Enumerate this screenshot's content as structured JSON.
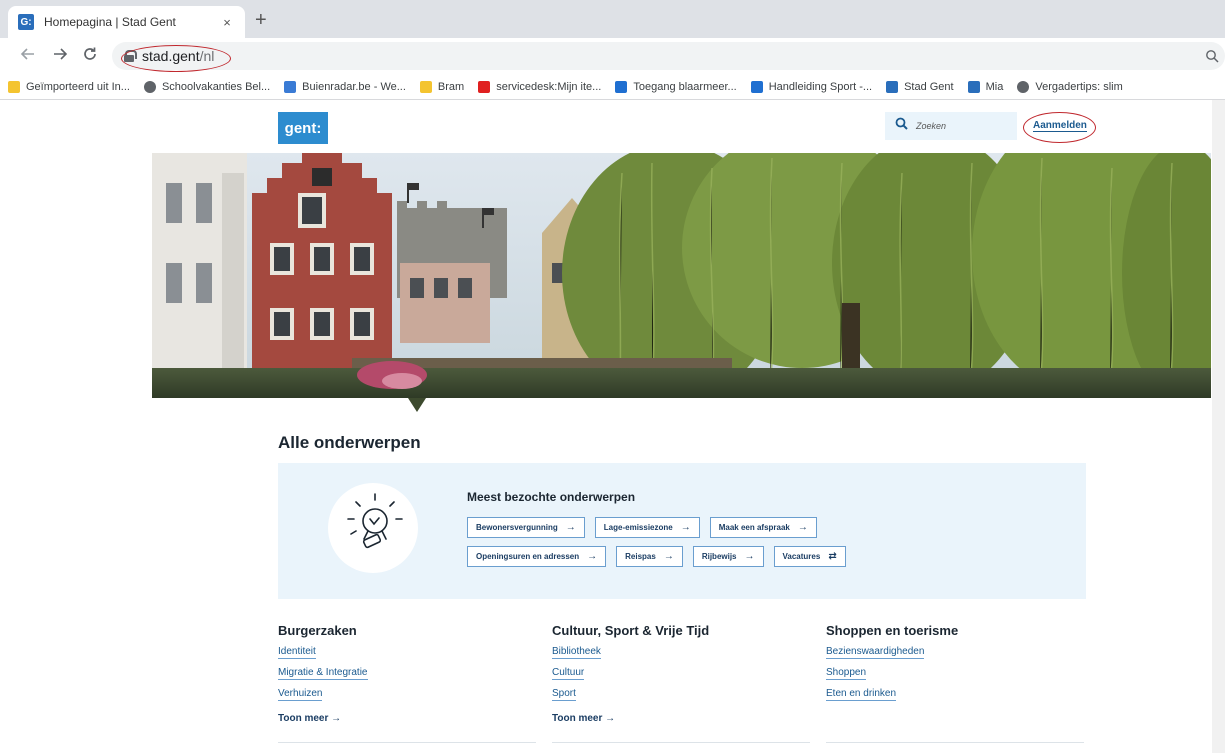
{
  "browser": {
    "tab_title": "Homepagina | Stad Gent",
    "favicon_text": "G:",
    "tab_close": "×",
    "new_tab": "+",
    "url_host": "stad.gent",
    "url_path": "/nl",
    "bookmarks": [
      {
        "label": "Geïmporteerd uit In...",
        "icon": "folder-icon",
        "color": "#f4c430"
      },
      {
        "label": "Schoolvakanties Bel...",
        "icon": "globe-icon",
        "color": "#5f6368"
      },
      {
        "label": "Buienradar.be - We...",
        "icon": "buienradar-icon",
        "color": "#3a7bd5"
      },
      {
        "label": "Bram",
        "icon": "folder-icon",
        "color": "#f4c430"
      },
      {
        "label": "servicedesk:Mijn ite...",
        "icon": "flag-icon",
        "color": "#e02020"
      },
      {
        "label": "Toegang blaarmeer...",
        "icon": "toegang-icon",
        "color": "#1f6fd1"
      },
      {
        "label": "Handleiding Sport -...",
        "icon": "cross-icon",
        "color": "#1f6fd1"
      },
      {
        "label": "Stad Gent",
        "icon": "gent-icon",
        "color": "#2a6ebb"
      },
      {
        "label": "Mia",
        "icon": "mia-icon",
        "color": "#2a6ebb"
      },
      {
        "label": "Vergadertips: slim",
        "icon": "globe-icon",
        "color": "#5f6368"
      }
    ]
  },
  "header": {
    "logo": "gent:",
    "search_placeholder": "Zoeken",
    "login_label": "Aanmelden"
  },
  "main": {
    "section_title": "Alle onderwerpen",
    "topics_heading": "Meest bezochte onderwerpen",
    "chips_row1": [
      {
        "label": "Bewonersvergunning",
        "arrow": "→"
      },
      {
        "label": "Lage-emissiezone",
        "arrow": "→"
      },
      {
        "label": "Maak een afspraak",
        "arrow": "→"
      }
    ],
    "chips_row2": [
      {
        "label": "Openingsuren en adressen",
        "arrow": "→"
      },
      {
        "label": "Reispas",
        "arrow": "→"
      },
      {
        "label": "Rijbewijs",
        "arrow": "→"
      },
      {
        "label": "Vacatures",
        "arrow": "⇄"
      }
    ],
    "columns": [
      {
        "title": "Burgerzaken",
        "links": [
          "Identiteit",
          "Migratie & Integratie",
          "Verhuizen"
        ],
        "more": "Toon meer →"
      },
      {
        "title": "Cultuur, Sport & Vrije Tijd",
        "links": [
          "Bibliotheek",
          "Cultuur",
          "Sport"
        ],
        "more": "Toon meer →"
      },
      {
        "title": "Shoppen en toerisme",
        "links": [
          "Bezienswaardigheden",
          "Shoppen",
          "Eten en drinken"
        ],
        "more": ""
      }
    ]
  },
  "colors": {
    "brand": "#2d8ccf",
    "link": "#1b5a8f",
    "panel": "#eaf4fb",
    "annotation": "#c0282e"
  }
}
